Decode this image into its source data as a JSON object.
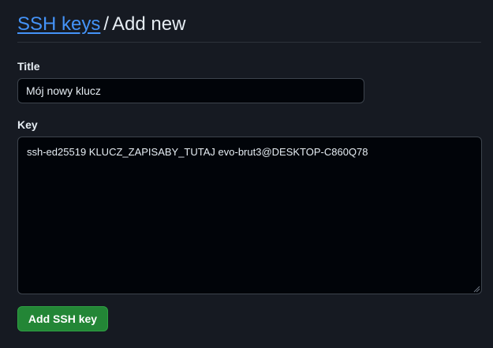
{
  "breadcrumb": {
    "parent_label": "SSH keys",
    "separator": "/",
    "current_label": "Add new"
  },
  "form": {
    "title_label": "Title",
    "title_value": "Mój nowy klucz",
    "key_label": "Key",
    "key_value": "ssh-ed25519 KLUCZ_ZAPISABY_TUTAJ evo-brut3@DESKTOP-C860Q78",
    "submit_label": "Add SSH key"
  },
  "colors": {
    "background": "#161a22",
    "link": "#4493f8",
    "button": "#238636",
    "input_background": "#010409"
  }
}
